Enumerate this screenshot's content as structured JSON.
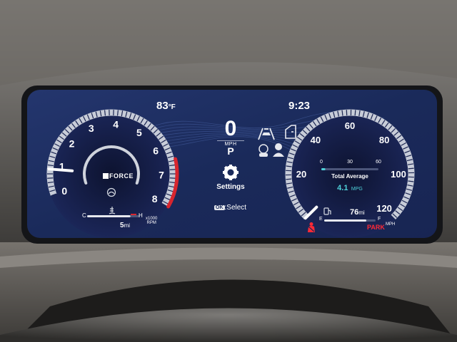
{
  "status_bar": {
    "temperature": "83",
    "temperature_unit": "°F",
    "clock": "9:23"
  },
  "tachometer": {
    "ticks": [
      "0",
      "1",
      "2",
      "3",
      "4",
      "5",
      "6",
      "7",
      "8"
    ],
    "unit_label": "x1000\nRPM",
    "logo_text": "FORCE",
    "redline_from": 6.5,
    "needle_value": 0.85
  },
  "temp_gauge": {
    "cold_label": "C",
    "hot_label": "H",
    "level": 0.82
  },
  "trip": {
    "distance": "5",
    "unit": "mi"
  },
  "center": {
    "speed": "0",
    "speed_unit": "MPH",
    "gear": "P",
    "settings_label": "Settings",
    "ok_key": "OK",
    "ok_hint": ":Select"
  },
  "speedometer": {
    "ticks": [
      "20",
      "40",
      "60",
      "80",
      "100",
      "120"
    ],
    "unit": "MPH",
    "needle_value": 0
  },
  "economy": {
    "scale": [
      "0",
      "30",
      "60"
    ],
    "label": "Total Average",
    "value": "4.1",
    "unit": "MPG",
    "level": 0.07
  },
  "fuel": {
    "empty_label": "E",
    "full_label": "F",
    "range": "76",
    "range_unit": "mi",
    "level": 0.82
  },
  "park_label": "PARK",
  "icons": [
    "lane-trace-icon",
    "driver-monitor-icon",
    "door-open-icon",
    "radar-cruise-icon",
    "seatbelt-warning-icon",
    "fuel-pump-icon",
    "coolant-icon",
    "settings-gear-icon",
    "drive-mode-icon"
  ],
  "colors": {
    "accent_teal": "#4fd1d9",
    "redline": "#d8252e",
    "park_red": "#ff2a36",
    "screen_bg": "#1c2d60"
  }
}
